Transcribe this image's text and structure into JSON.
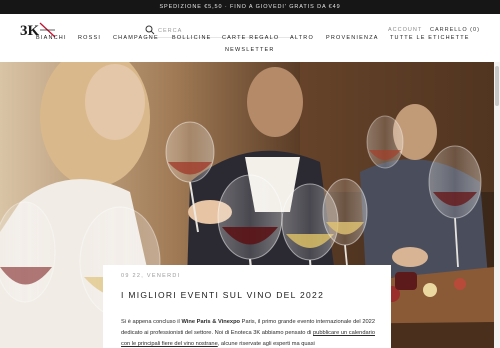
{
  "announcement": "SPEDIZIONE €5,50 · FINO A GIOVEDI' GRATIS DA €49",
  "header": {
    "logo_text": "3K",
    "search_placeholder": "CERCA",
    "account_label": "ACCOUNT",
    "cart_label": "CARRELLO (0)"
  },
  "nav": {
    "items": [
      "BIANCHI",
      "ROSSI",
      "CHAMPAGNE",
      "BOLLICINE",
      "CARTE REGALO",
      "ALTRO",
      "PROVENIENZA",
      "TUTTE LE ETICHETTE",
      "NEWSLETTER"
    ]
  },
  "article": {
    "date": "09 22, VENERDI",
    "title": "I MIGLIORI EVENTI SUL VINO DEL 2022",
    "p_lead": "Si è appena concluso il ",
    "p_bold": "Wine Paris & Vinexpo",
    "p_mid": " Paris, il primo grande evento internazionale del 2022 dedicato ai professionisti del settore. Noi di Enoteca 3K abbiamo pensato di ",
    "p_link": "pubblicare un calendario con le principali fiere del vino nostrane",
    "p_tail": ", alcune riservate agli esperti ma quasi"
  },
  "colors": {
    "announcement_bg": "#161616",
    "logo_accent": "#c8102e",
    "text": "#1a1a1a"
  },
  "icons": {
    "search": "search-icon",
    "logo": "logo-3k"
  }
}
